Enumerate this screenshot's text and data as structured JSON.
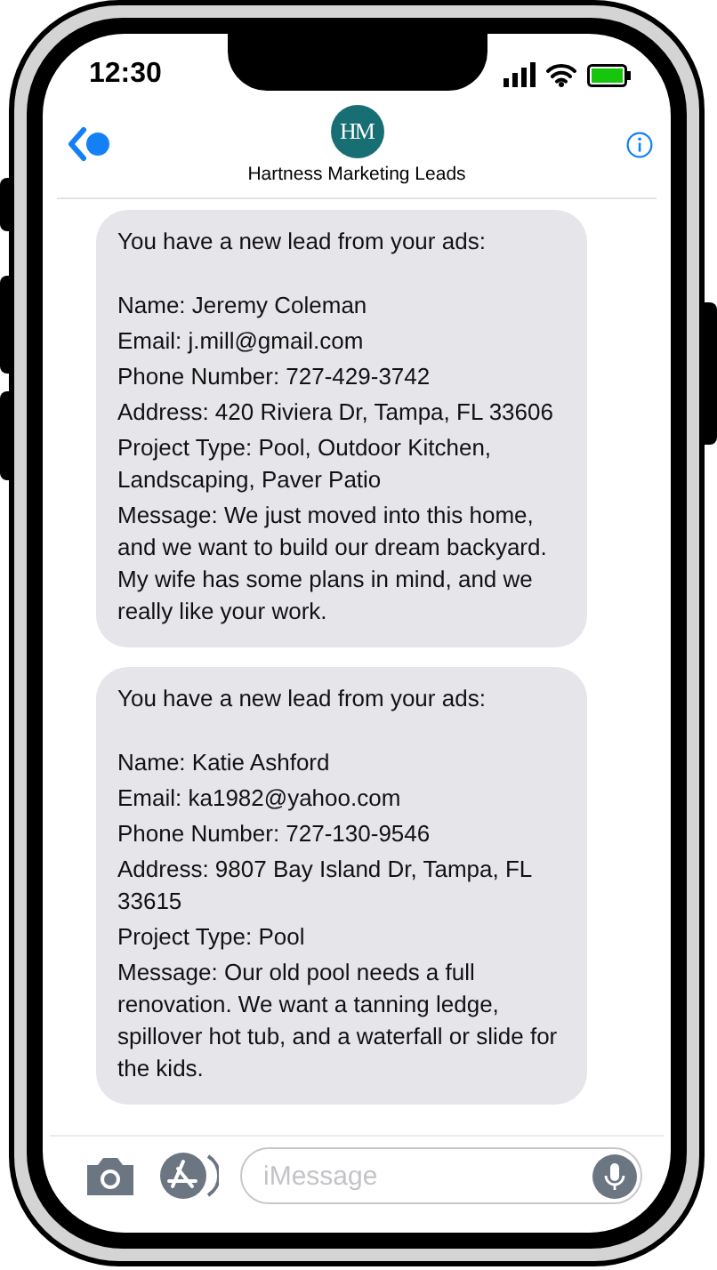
{
  "status_bar": {
    "time": "12:30"
  },
  "header": {
    "logo_text": "HM",
    "contact_name": "Hartness Marketing Leads"
  },
  "messages": [
    {
      "intro": "You have a new lead from your ads:",
      "lines": [
        "Name: Jeremy Coleman",
        "Email: j.mill@gmail.com",
        "Phone Number: 727-429-3742",
        "Address: 420 Riviera Dr, Tampa, FL 33606",
        "Project Type: Pool, Outdoor Kitchen, Landscaping, Paver Patio",
        "Message: We just moved into this home, and we want to build our dream backyard. My wife has some plans in mind, and we really like your work."
      ]
    },
    {
      "intro": "You have a new lead from your ads:",
      "lines": [
        "Name: Katie Ashford",
        "Email: ka1982@yahoo.com",
        "Phone Number: 727-130-9546",
        "Address: 9807 Bay Island Dr, Tampa, FL 33615",
        "Project Type: Pool",
        "Message: Our old pool needs a full renovation. We want a tanning ledge, spillover hot tub, and a waterfall or slide for the kids."
      ]
    }
  ],
  "input_bar": {
    "placeholder": "iMessage"
  }
}
